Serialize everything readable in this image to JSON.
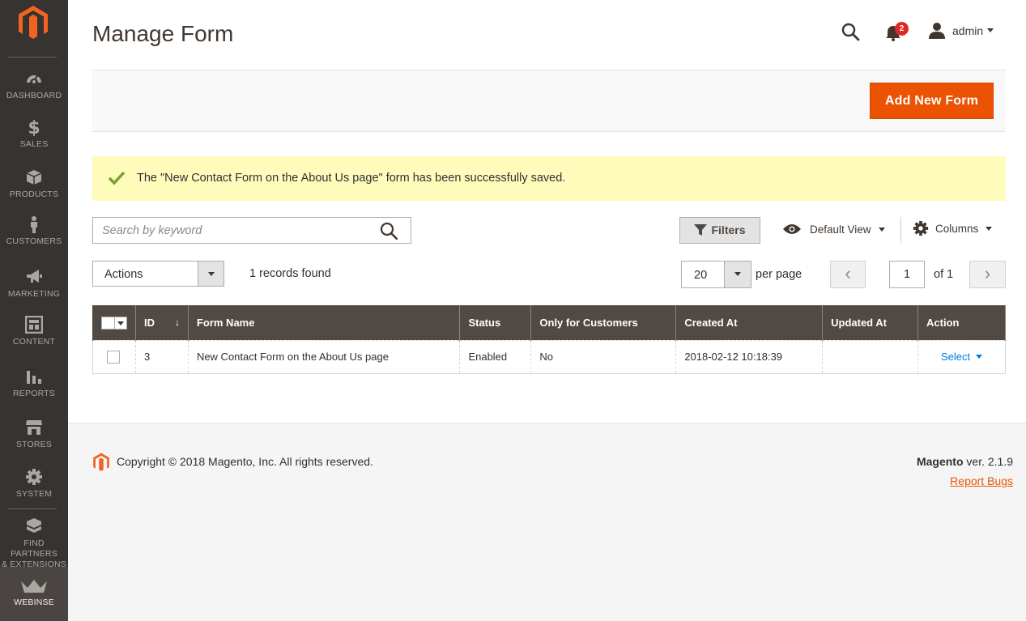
{
  "nav": {
    "items": [
      {
        "label": "Dashboard",
        "icon": "dashboard-icon"
      },
      {
        "label": "Sales",
        "icon": "dollar-icon"
      },
      {
        "label": "Products",
        "icon": "box-icon"
      },
      {
        "label": "Customers",
        "icon": "person-icon"
      },
      {
        "label": "Marketing",
        "icon": "megaphone-icon"
      },
      {
        "label": "Content",
        "icon": "content-icon"
      },
      {
        "label": "Reports",
        "icon": "bar-chart-icon"
      },
      {
        "label": "Stores",
        "icon": "storefront-icon"
      },
      {
        "label": "System",
        "icon": "gear-icon"
      }
    ],
    "partners_line1": "Find Partners",
    "partners_line2": "& Extensions",
    "active_label": "Webinse"
  },
  "header": {
    "title": "Manage Form",
    "notification_count": "2",
    "user": "admin"
  },
  "toolbar": {
    "add_label": "Add New Form"
  },
  "message": {
    "text": "The \"New Contact Form on the About Us page\" form has been successfully saved."
  },
  "grid_controls": {
    "search_placeholder": "Search by keyword",
    "filters_label": "Filters",
    "view_label": "Default View",
    "columns_label": "Columns",
    "actions_label": "Actions",
    "records_found": "1 records found",
    "per_page_value": "20",
    "per_page_label": "per page",
    "page_current": "1",
    "page_of": "of 1"
  },
  "grid": {
    "columns": [
      "ID",
      "Form Name",
      "Status",
      "Only for Customers",
      "Created At",
      "Updated At",
      "Action"
    ],
    "sort_indicator": "↓",
    "rows": [
      {
        "id": "3",
        "name": "New Contact Form on the About Us page",
        "status": "Enabled",
        "only_customers": "No",
        "created": "2018-02-12 10:18:39",
        "updated": "",
        "action": "Select"
      }
    ]
  },
  "footer": {
    "copyright": "Copyright © 2018 Magento, Inc. All rights reserved.",
    "brand": "Magento",
    "version": " ver. 2.1.9",
    "report_bugs": "Report Bugs"
  },
  "colors": {
    "sidebar": "#373330",
    "accent": "#eb5202",
    "grid_header": "#514943",
    "success_bg": "#fffbbb",
    "link": "#007bdb"
  }
}
